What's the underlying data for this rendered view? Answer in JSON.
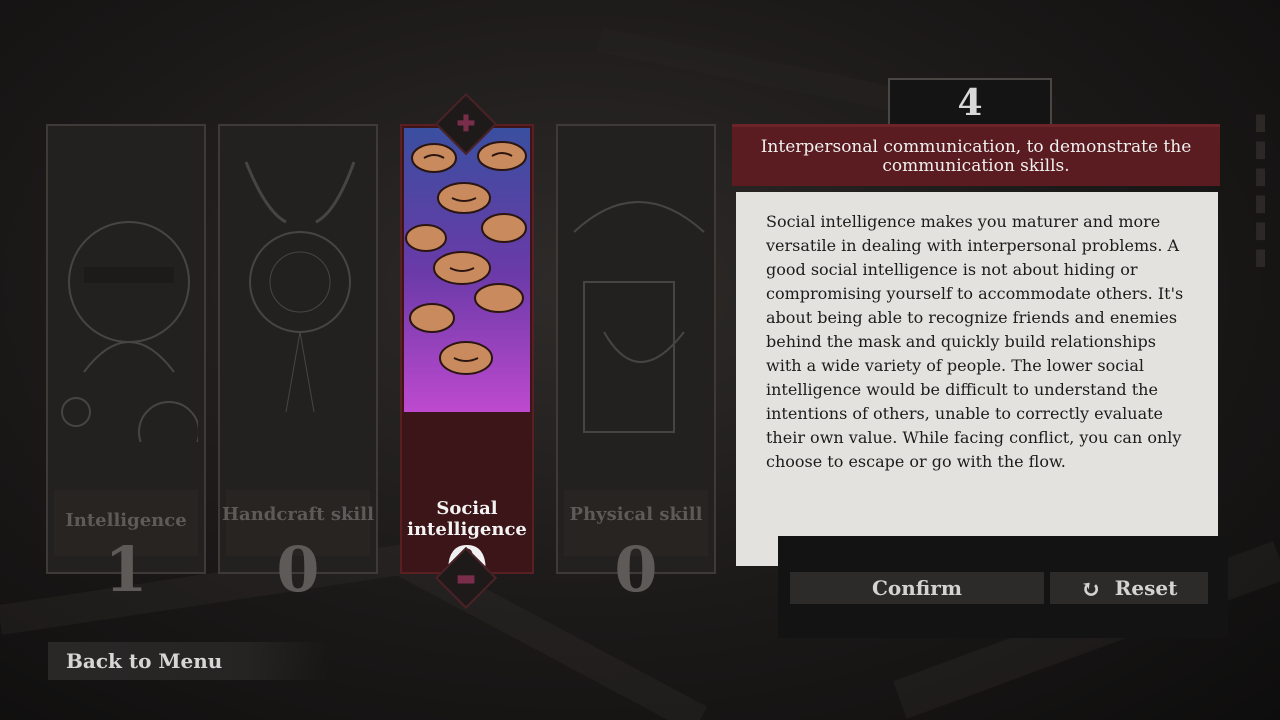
{
  "cards": [
    {
      "value": "1",
      "label": "Intelligence"
    },
    {
      "value": "0",
      "label": "Handcraft skill"
    },
    {
      "value": "0",
      "label": "Social intelligence"
    },
    {
      "value": "0",
      "label": "Physical skill"
    }
  ],
  "points_remaining": "4",
  "detail": {
    "header": "Interpersonal communication, to demonstrate the communication skills.",
    "body": "Social intelligence makes you maturer and more versatile in dealing with interpersonal problems.  A good social intelligence is not about hiding or compromising yourself to accommodate others. It's about being able to recognize friends and enemies behind the mask and quickly build relationships with a wide variety of people.  The lower social intelligence would be difficult to understand the intentions of others, unable to correctly evaluate their own value. While facing conflict, you can only choose to escape or go with the flow."
  },
  "buttons": {
    "confirm": "Confirm",
    "reset": "Reset",
    "back": "Back to Menu"
  },
  "icons": {
    "increase": "plus-icon",
    "decrease": "minus-icon",
    "reset": "reset-icon"
  },
  "colors": {
    "accent_red": "#5a1c20",
    "paper": "#e4e2de"
  }
}
